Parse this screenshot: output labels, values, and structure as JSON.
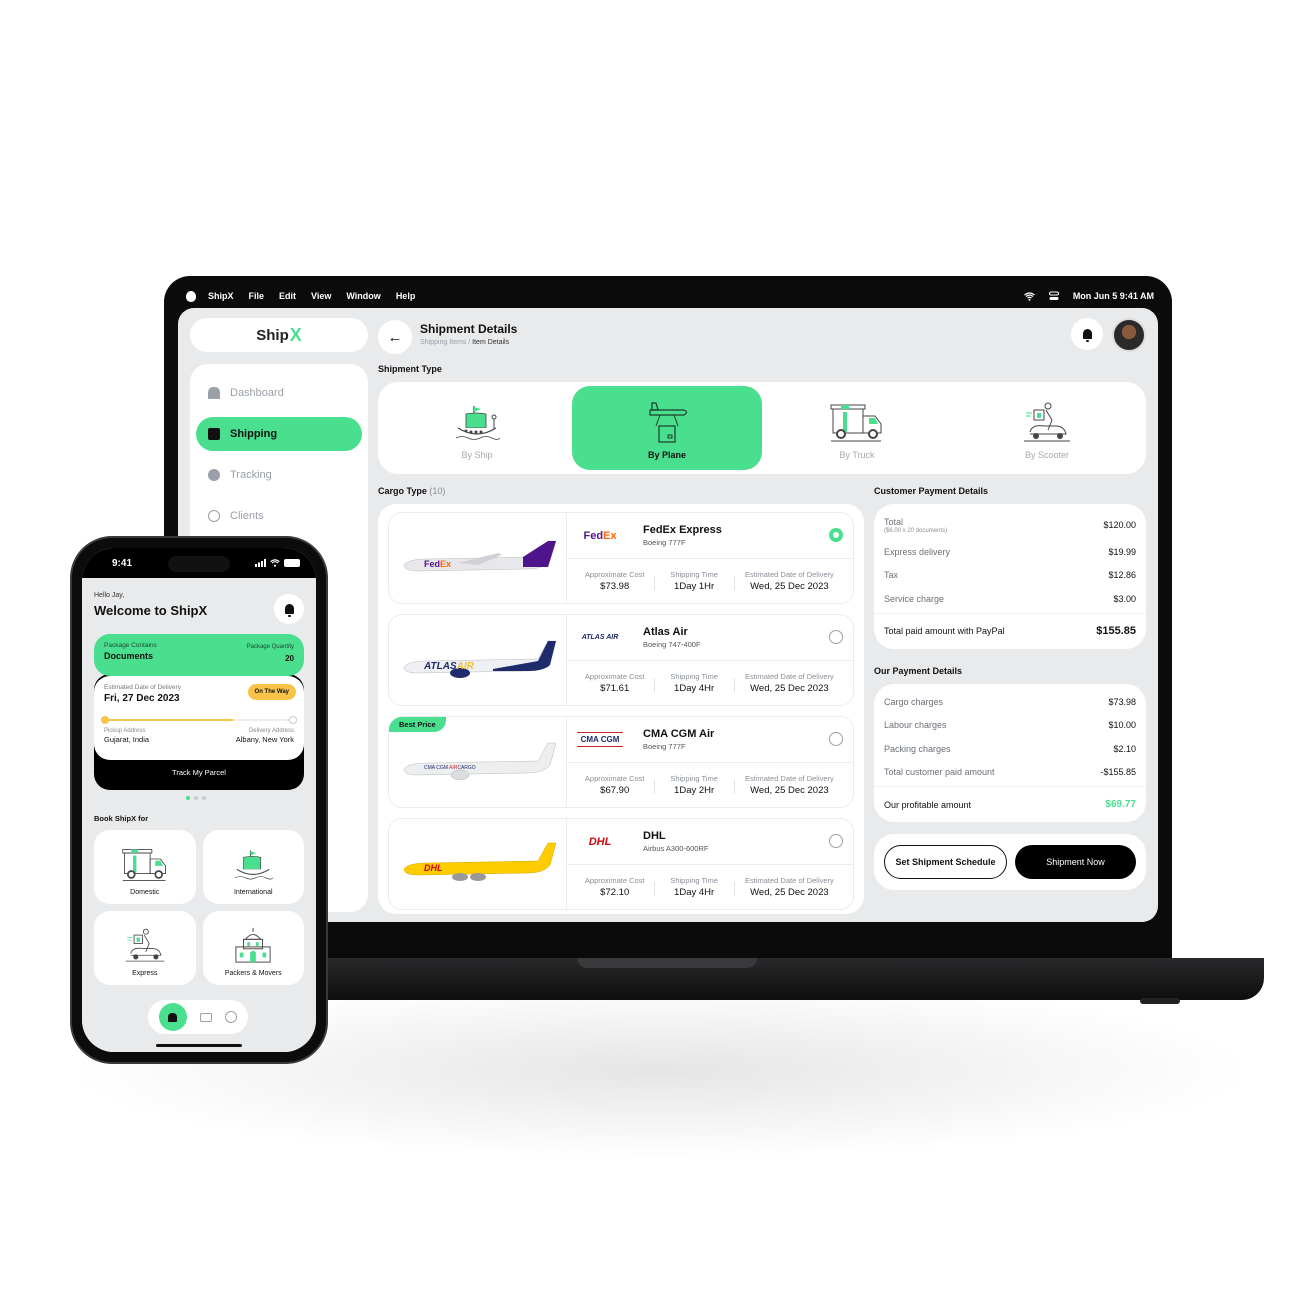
{
  "menubar": {
    "app": "ShipX",
    "items": [
      "File",
      "Edit",
      "View",
      "Window",
      "Help"
    ],
    "clock": "Mon Jun 5  9:41 AM"
  },
  "brand": {
    "name": "Ship",
    "mark": "X",
    "accent": "#49df8f"
  },
  "sidebar": {
    "items": [
      {
        "label": "Dashboard",
        "icon": "home-icon",
        "active": false
      },
      {
        "label": "Shipping",
        "icon": "box-icon",
        "active": true
      },
      {
        "label": "Tracking",
        "icon": "navigation-icon",
        "active": false
      },
      {
        "label": "Clients",
        "icon": "user-circle-icon",
        "active": false
      }
    ]
  },
  "header": {
    "title": "Shipment Details",
    "breadcrumb_parent": "Shipping Items",
    "breadcrumb_sep": " / ",
    "breadcrumb_current": "Item Details"
  },
  "shipment_type": {
    "label": "Shipment Type",
    "options": [
      {
        "label": "By Ship",
        "icon": "ship-icon",
        "selected": false
      },
      {
        "label": "By Plane",
        "icon": "plane-icon",
        "selected": true
      },
      {
        "label": "By Truck",
        "icon": "truck-icon",
        "selected": false
      },
      {
        "label": "By Scooter",
        "icon": "scooter-icon",
        "selected": false
      }
    ]
  },
  "cargo": {
    "label": "Cargo Type",
    "count": "(10)",
    "labels": {
      "cost": "Approximate Cost",
      "time": "Shipping Time",
      "eta": "Estimated Date of Delivery"
    },
    "items": [
      {
        "carrier": "FedEx Express",
        "logo": "FedEx",
        "aircraft": "Boeing 777F",
        "cost": "$73.98",
        "time": "1Day 1Hr",
        "eta": "Wed, 25 Dec 2023",
        "selected": true,
        "badge": ""
      },
      {
        "carrier": "Atlas Air",
        "logo": "ATLAS AIR",
        "aircraft": "Boeing 747-400F",
        "cost": "$71.61",
        "time": "1Day 4Hr",
        "eta": "Wed, 25 Dec 2023",
        "selected": false,
        "badge": ""
      },
      {
        "carrier": "CMA CGM Air",
        "logo": "CMA CGM",
        "aircraft": "Boeing 777F",
        "cost": "$67.90",
        "time": "1Day 2Hr",
        "eta": "Wed, 25 Dec 2023",
        "selected": false,
        "badge": "Best Price"
      },
      {
        "carrier": "DHL",
        "logo": "DHL",
        "aircraft": "Airbus A300-600RF",
        "cost": "$72.10",
        "time": "1Day 4Hr",
        "eta": "Wed, 25 Dec 2023",
        "selected": false,
        "badge": ""
      }
    ]
  },
  "customer_payment": {
    "label": "Customer Payment Details",
    "rows": [
      {
        "label": "Total",
        "sub": "($6.00 x 20 documents)",
        "amount": "$120.00"
      },
      {
        "label": "Express delivery",
        "amount": "$19.99"
      },
      {
        "label": "Tax",
        "amount": "$12.86"
      },
      {
        "label": "Service charge",
        "amount": "$3.00"
      }
    ],
    "total_label": "Total paid amount with PayPal",
    "total_amount": "$155.85"
  },
  "our_payment": {
    "label": "Our Payment Details",
    "rows": [
      {
        "label": "Cargo charges",
        "amount": "$73.98"
      },
      {
        "label": "Labour charges",
        "amount": "$10.00"
      },
      {
        "label": "Packing charges",
        "amount": "$2.10"
      },
      {
        "label": "Total customer paid amount",
        "amount": "-$155.85"
      }
    ],
    "total_label": "Our profitable amount",
    "total_amount": "$69.77"
  },
  "actions": {
    "schedule": "Set Shipment Schedule",
    "ship_now": "Shipment Now"
  },
  "phone": {
    "time": "9:41",
    "greeting": "Hello Jay,",
    "welcome": "Welcome to ShipX",
    "package": {
      "contains_label": "Package Contains",
      "contains": "Documents",
      "qty_label": "Package Quantity",
      "qty": "20"
    },
    "delivery": {
      "eta_label": "Estimated Date of Delivery",
      "eta": "Fri, 27 Dec 2023",
      "status": "On The Way",
      "progress": 0.68,
      "pickup_label": "Pickup Address",
      "pickup": "Gujarat, India",
      "delivery_label": "Delivery Address",
      "delivery": "Albany, New York"
    },
    "track_label": "Track My Parcel",
    "carousel": {
      "pages": 3,
      "current": 1
    },
    "book_label": "Book ShipX for",
    "services": [
      {
        "label": "Domestic",
        "icon": "truck-icon"
      },
      {
        "label": "International",
        "icon": "ship-icon"
      },
      {
        "label": "Express",
        "icon": "scooter-icon"
      },
      {
        "label": "Packers & Movers",
        "icon": "building-icon"
      }
    ],
    "tabs": [
      "home-icon",
      "parcel-icon",
      "profile-icon"
    ]
  }
}
